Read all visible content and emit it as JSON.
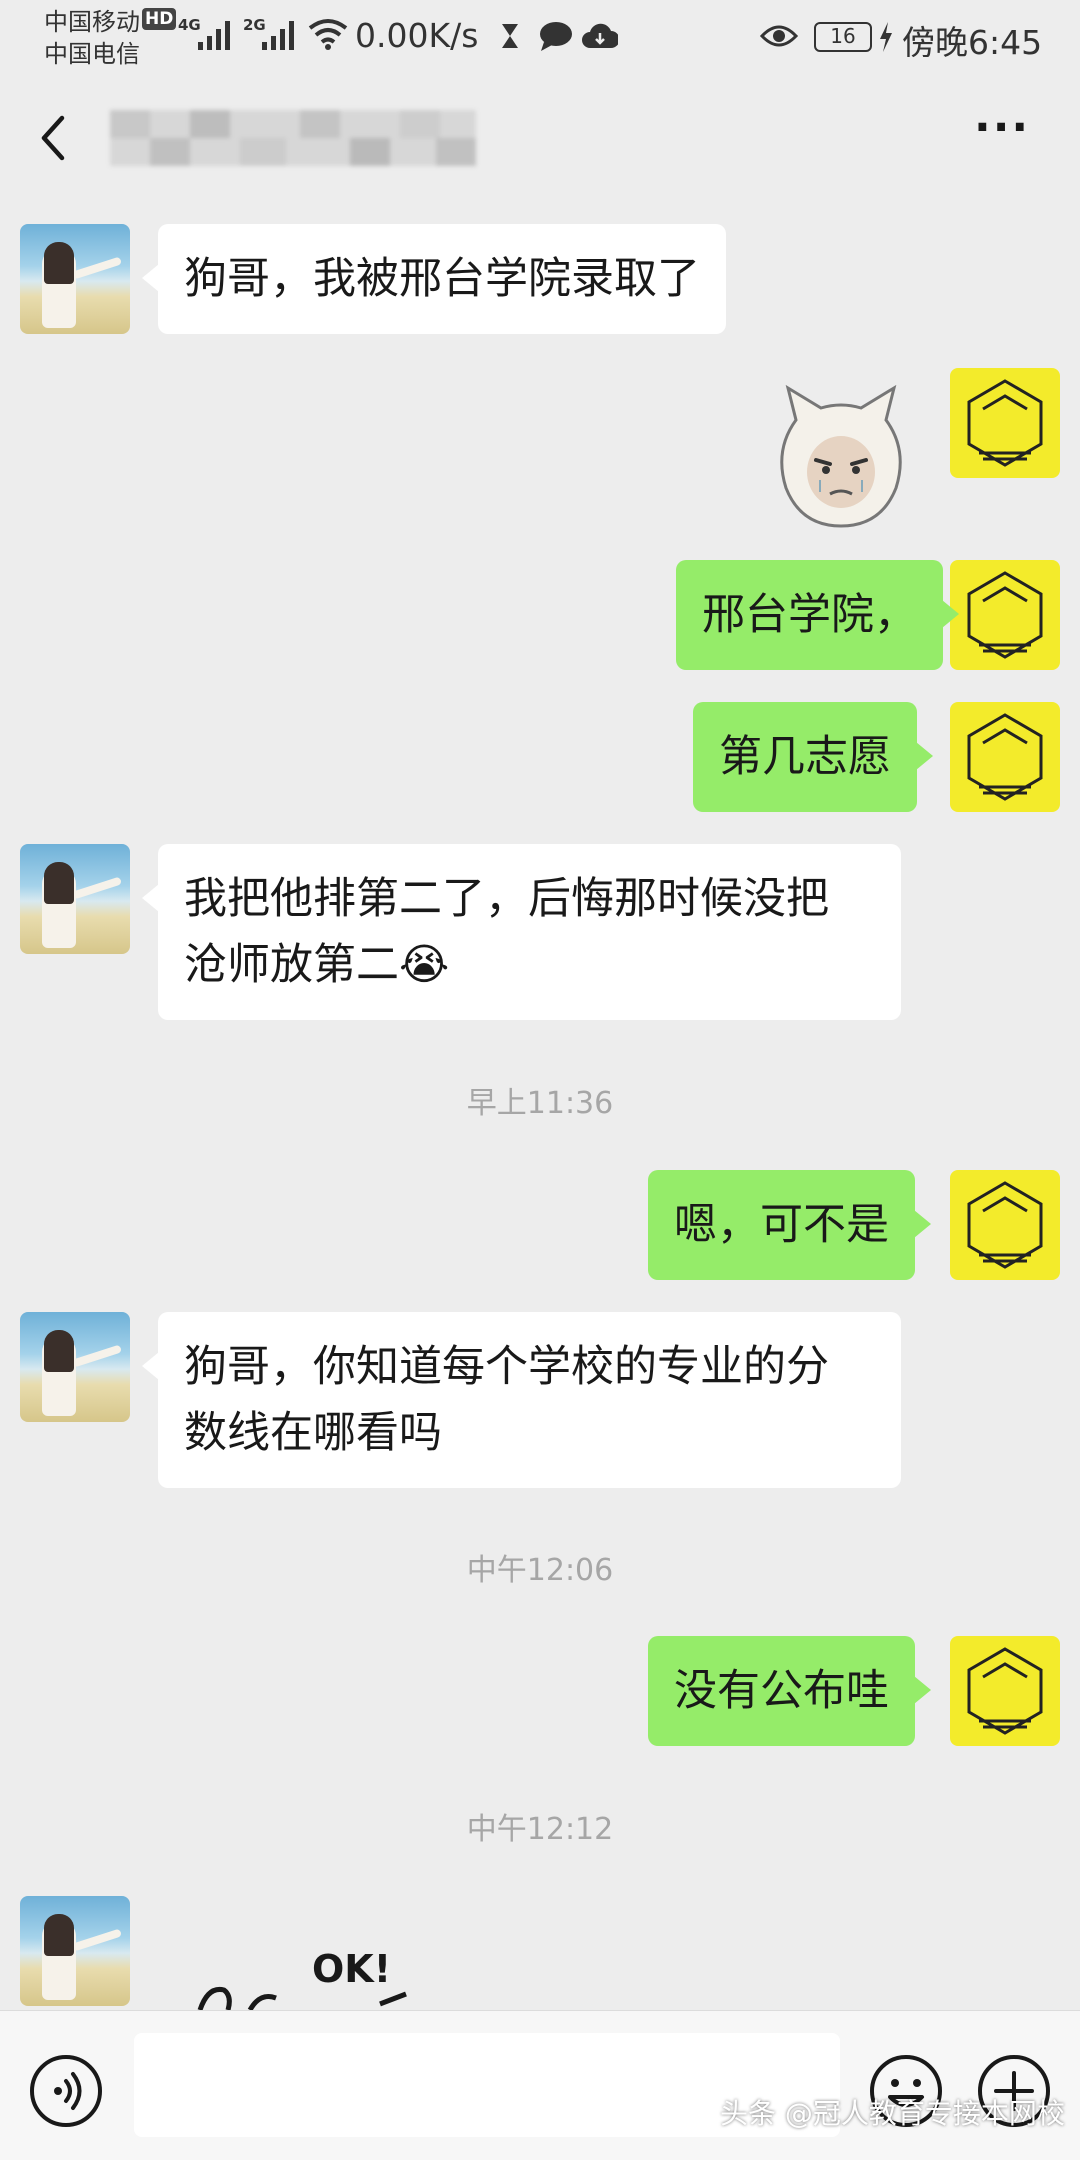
{
  "status_bar": {
    "carrier1": "中国移动",
    "carrier2": "中国电信",
    "hd": "HD",
    "net1": "4G",
    "net2": "2G",
    "speed": "0.00K/s",
    "battery": "16",
    "time": "傍晚6:45"
  },
  "nav": {
    "title": "",
    "more_label": "···"
  },
  "messages": [
    {
      "side": "in",
      "text": "狗哥，我被邢台学院录取了"
    },
    {
      "side": "out",
      "type": "sticker",
      "icon": "crying-baby-face-sticker"
    },
    {
      "side": "out",
      "text": "邢台学院，"
    },
    {
      "side": "out",
      "text": "第几志愿"
    },
    {
      "side": "in",
      "lines": [
        "我把他排第二了，后悔那时候没把",
        "沧师放第二"
      ],
      "emoji": "😭"
    },
    {
      "side": "out",
      "text": "嗯，可不是"
    },
    {
      "side": "in",
      "lines": [
        "狗哥，你知道每个学校的专业的分",
        "数线在哪看吗"
      ]
    },
    {
      "side": "out",
      "text": "没有公布哇"
    },
    {
      "side": "in",
      "type": "sticker",
      "icon": "ok-hand-drawn-sticker",
      "sticker_text": "OK!"
    }
  ],
  "timestamps": [
    "早上11:36",
    "中午12:06",
    "中午12:12"
  ],
  "input": {
    "placeholder": ""
  },
  "watermark": "头条 @冠人教育专接本网校",
  "colors": {
    "background": "#ededed",
    "bubble_in": "#ffffff",
    "bubble_out": "#95ec69",
    "self_avatar": "#f3eb2b"
  }
}
